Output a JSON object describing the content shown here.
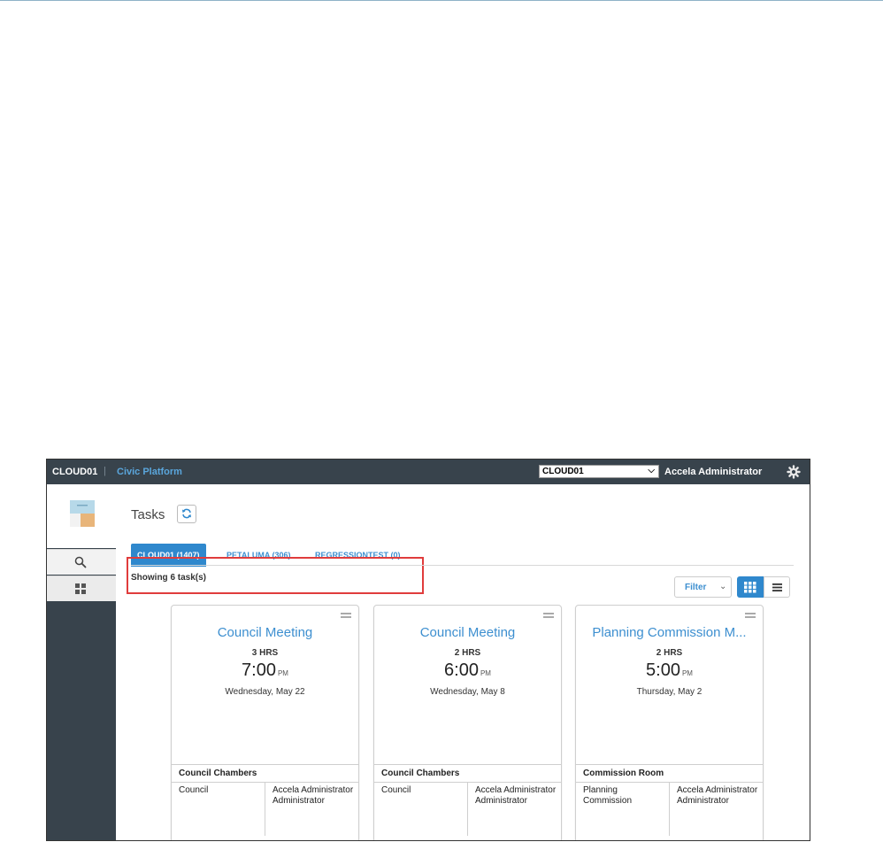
{
  "header": {
    "agency": "CLOUD01",
    "separator": "|",
    "product": "Civic Platform",
    "agency_select": {
      "selected": "CLOUD01"
    },
    "user": "Accela Administrator"
  },
  "page": {
    "title": "Tasks",
    "showing": "Showing 6 task(s)"
  },
  "tabs": [
    {
      "label": "CLOUD01 (1407)",
      "active": true
    },
    {
      "label": "PETALUMA (306)",
      "active": false
    },
    {
      "label": "REGRESSIONTEST (0)",
      "active": false
    }
  ],
  "toolbar": {
    "filter_label": "Filter",
    "filter_chevron": "⌄"
  },
  "cards": [
    {
      "title": "Council Meeting",
      "duration": "3 HRS",
      "time": "7:00",
      "ampm": "PM",
      "date": "Wednesday, May 22",
      "location": "Council Chambers",
      "col1": "Council",
      "col2": "Accela Administrator Administrator"
    },
    {
      "title": "Council Meeting",
      "duration": "2 HRS",
      "time": "6:00",
      "ampm": "PM",
      "date": "Wednesday, May 8",
      "location": "Council Chambers",
      "col1": "Council",
      "col2": "Accela Administrator Administrator"
    },
    {
      "title": "Planning Commission M...",
      "duration": "2 HRS",
      "time": "5:00",
      "ampm": "PM",
      "date": "Thursday, May 2",
      "location": "Commission Room",
      "col1": "Planning Commission",
      "col2": "Accela Administrator Administrator"
    }
  ],
  "colors": {
    "topbar": "#38434c",
    "accent": "#2f88cd",
    "highlight": "#e03c3c"
  },
  "icons": [
    "gear-icon",
    "search-icon",
    "apps-grid-icon",
    "refresh-icon",
    "grid-view-icon",
    "list-view-icon",
    "drag-handle-icon",
    "logo-icon"
  ]
}
